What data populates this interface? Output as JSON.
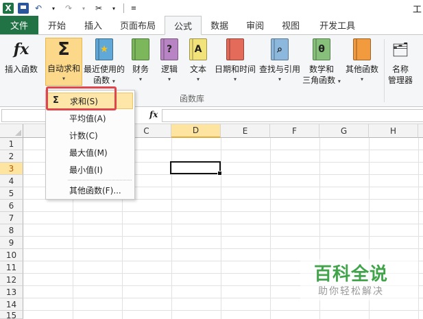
{
  "title_bar": {
    "title_fragment": "工"
  },
  "tabs": [
    {
      "label": "文件"
    },
    {
      "label": "开始"
    },
    {
      "label": "插入"
    },
    {
      "label": "页面布局"
    },
    {
      "label": "公式"
    },
    {
      "label": "数据"
    },
    {
      "label": "审阅"
    },
    {
      "label": "视图"
    },
    {
      "label": "开发工具"
    }
  ],
  "active_tab": "公式",
  "ribbon": {
    "insert_function": {
      "label": "插入函数",
      "icon": "fx-icon"
    },
    "autosum": {
      "label1": "自动求和",
      "arrow": "▾",
      "icon": "sigma-icon"
    },
    "recently_used": {
      "label1": "最近使用的",
      "label2": "函数",
      "arrow": "▾"
    },
    "financial": {
      "label1": "财务",
      "arrow": "▾"
    },
    "logical": {
      "label1": "逻辑",
      "arrow": "▾",
      "glyph": "?"
    },
    "text": {
      "label1": "文本",
      "arrow": "▾",
      "glyph": "A"
    },
    "datetime": {
      "label1": "日期和时间",
      "arrow": "▾"
    },
    "lookup": {
      "label1": "查找与引用",
      "arrow": "▾"
    },
    "math": {
      "label1": "数学和",
      "label2": "三角函数",
      "arrow": "▾",
      "glyph": "θ"
    },
    "more": {
      "label1": "其他函数",
      "arrow": "▾"
    },
    "name_manager": {
      "label1": "名称",
      "label2": "管理器"
    },
    "group_label": "函数库"
  },
  "formula_bar": {
    "fx": "fx",
    "formula": ""
  },
  "columns": [
    "C",
    "D",
    "E",
    "F",
    "G",
    "H"
  ],
  "selected_column": "D",
  "rows": [
    "1",
    "2",
    "3",
    "4",
    "5",
    "6",
    "7",
    "8",
    "9",
    "10",
    "11",
    "12",
    "13",
    "14",
    "15"
  ],
  "selected_row": "3",
  "menu": {
    "icon": "Σ",
    "items": [
      {
        "label": "求和(S)"
      },
      {
        "label": "平均值(A)"
      },
      {
        "label": "计数(C)"
      },
      {
        "label": "最大值(M)"
      },
      {
        "label": "最小值(I)"
      },
      {
        "label": "其他函数(F)..."
      }
    ]
  },
  "watermark": {
    "title": "百科全说",
    "subtitle": "助你轻松解决"
  },
  "colors": {
    "file_tab": "#217346",
    "selection": "#fde4a0",
    "highlight_box": "#e0454b",
    "watermark": "#41a44b"
  }
}
